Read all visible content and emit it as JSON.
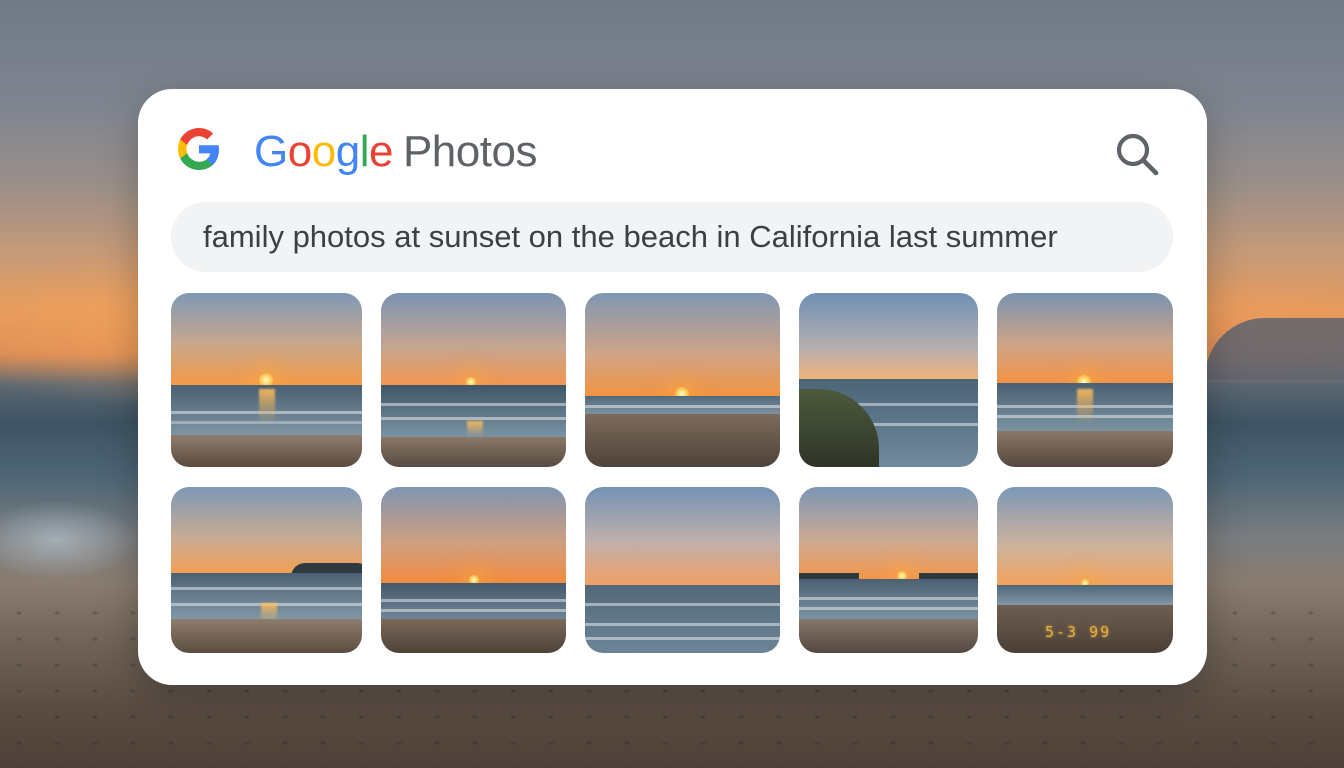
{
  "app": {
    "brand_letters": [
      "G",
      "o",
      "o",
      "g",
      "l",
      "e"
    ],
    "product": "Photos"
  },
  "icons": {
    "logo": "google-g-icon",
    "search": "search-icon"
  },
  "colors": {
    "google_blue": "#4285F4",
    "google_red": "#EA4335",
    "google_yellow": "#FBBC05",
    "google_green": "#34A853",
    "text_gray": "#5f6368",
    "search_bar_bg": "#f1f3f4"
  },
  "search": {
    "query": "family photos at sunset on the beach in California last summer"
  },
  "results": {
    "rows": 2,
    "columns": 5,
    "photo_10_sand_text": "5-3  99"
  }
}
